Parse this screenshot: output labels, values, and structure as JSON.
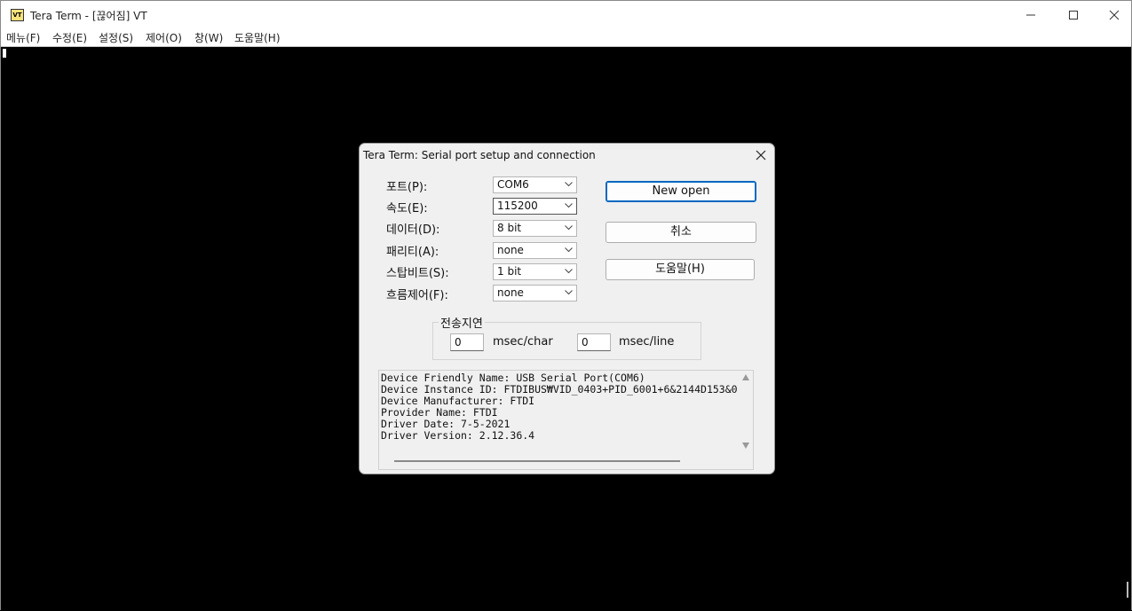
{
  "window": {
    "title": "Tera Term - [끊어짐] VT",
    "icon_text": "VT",
    "icon": "teraterm-vt-icon"
  },
  "menu": [
    "메뉴(F)",
    "수정(E)",
    "설정(S)",
    "제어(O)",
    "창(W)",
    "도움말(H)"
  ],
  "dialog": {
    "title": "Tera Term: Serial port setup and connection",
    "fields": [
      {
        "label": "포트(P):",
        "value": "COM6"
      },
      {
        "label": "속도(E):",
        "value": "115200"
      },
      {
        "label": "데이터(D):",
        "value": "8 bit"
      },
      {
        "label": "패리티(A):",
        "value": "none"
      },
      {
        "label": "스탑비트(S):",
        "value": "1 bit"
      },
      {
        "label": "흐름제어(F):",
        "value": "none"
      }
    ],
    "buttons": {
      "open": "New open",
      "cancel": "취소",
      "help": "도움말(H)"
    },
    "delay": {
      "group_label": "전송지연",
      "char_value": "0",
      "char_unit": "msec/char",
      "line_value": "0",
      "line_unit": "msec/line"
    },
    "info_lines": [
      "Device Friendly Name: USB Serial Port(COM6)",
      "Device Instance ID: FTDIBUS₩VID_0403+PID_6001+6&2144D153&0",
      "Device Manufacturer: FTDI",
      "Provider Name: FTDI",
      "Driver Date: 7-5-2021",
      "Driver Version: 2.12.36.4"
    ]
  },
  "colors": {
    "terminal_bg": "#000000",
    "dialog_bg": "#f0f0f0",
    "accent": "#0067c0"
  }
}
